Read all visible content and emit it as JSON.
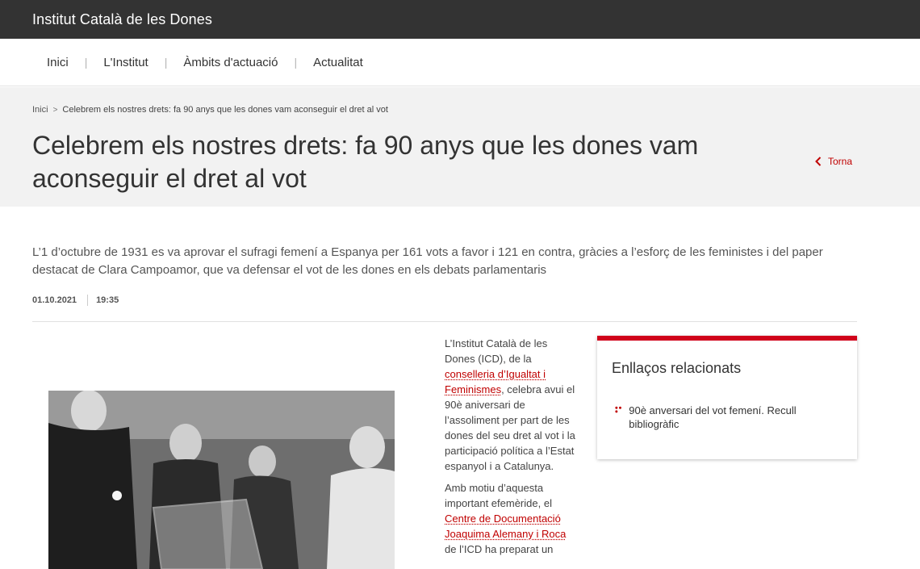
{
  "header": {
    "site_title": "Institut Català de les Dones"
  },
  "nav": {
    "items": [
      "Inici",
      "L'Institut",
      "Àmbits d'actuació",
      "Actualitat"
    ]
  },
  "breadcrumb": {
    "home": "Inici",
    "current": "Celebrem els nostres drets: fa 90 anys que les dones vam aconseguir el dret al vot"
  },
  "page": {
    "title": "Celebrem els nostres drets: fa 90 anys que les dones vam aconseguir el dret al vot",
    "back_label": "Torna",
    "lead": "L’1 d’octubre de 1931 es va aprovar el sufragi femení a Espanya per 161 vots a favor i 121 en contra, gràcies a l’esforç de les feministes i del paper destacat de Clara Campoamor, que va defensar el vot de les dones en els debats parlamentaris",
    "date": "01.10.2021",
    "time": "19:35"
  },
  "body": {
    "p1_pre": "L’Institut Català de les Dones (ICD), de la ",
    "p1_link": "conselleria d’Igualtat i Feminismes",
    "p1_post": ", celebra avui el 90è aniversari de l’assoliment per part de les dones del seu dret al vot i la participació política a l’Estat espanyol i a Catalunya.",
    "p2_pre": "Amb motiu d’aquesta important efemèride, el ",
    "p2_link": "Centre de Documentació Joaquima Alemany i Roca",
    "p2_post": " de l’ICD ha preparat un"
  },
  "related": {
    "title": "Enllaços relacionats",
    "items": [
      "90è anversari del vot femení. Recull bibliogràfic"
    ]
  },
  "colors": {
    "accent": "#c00000",
    "topbar": "#333333",
    "hero_bg": "#f2f2f2"
  }
}
